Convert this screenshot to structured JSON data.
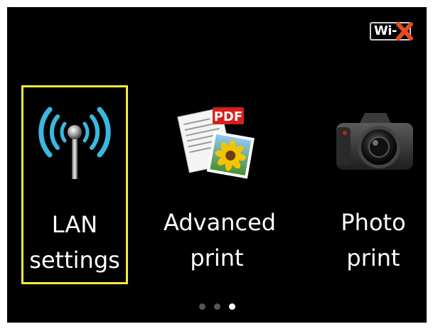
{
  "status": {
    "wifi_label": "Wi-",
    "wifi_state_icon": "wifi-disconnected-icon",
    "error_color": "#e84b1e"
  },
  "menu": {
    "selected_index": 0,
    "highlight_color": "#f2ee38",
    "items": [
      {
        "line1": "LAN",
        "line2": "settings",
        "icon": "wireless-antenna-icon"
      },
      {
        "line1": "Advanced",
        "line2": "print",
        "icon": "pdf-document-icon",
        "badge": "PDF"
      },
      {
        "line1": "Photo",
        "line2": "print",
        "icon": "camera-icon"
      }
    ]
  },
  "pager": {
    "page_count": 3,
    "current_page": 3
  }
}
